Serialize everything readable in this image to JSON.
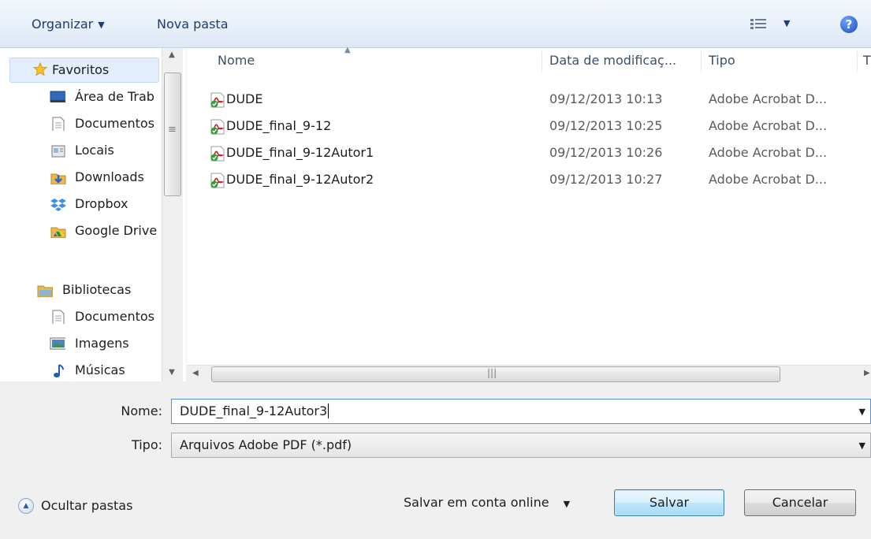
{
  "toolbar": {
    "organize_label": "Organizar",
    "new_folder_label": "Nova pasta",
    "help_glyph": "?"
  },
  "nav": {
    "favorites_label": "Favoritos",
    "items": [
      {
        "label": "Área de Trab",
        "icon": "desktop-icon"
      },
      {
        "label": "Documentos",
        "icon": "document-icon"
      },
      {
        "label": "Locais",
        "icon": "places-icon"
      },
      {
        "label": "Downloads",
        "icon": "downloads-icon"
      },
      {
        "label": "Dropbox",
        "icon": "dropbox-icon"
      },
      {
        "label": "Google Drive",
        "icon": "google-drive-icon"
      }
    ],
    "libraries_label": "Bibliotecas",
    "library_items": [
      {
        "label": "Documentos",
        "icon": "document-icon"
      },
      {
        "label": "Imagens",
        "icon": "pictures-icon"
      },
      {
        "label": "Músicas",
        "icon": "music-icon"
      }
    ]
  },
  "columns": {
    "name": "Nome",
    "modified": "Data de modificaç...",
    "type": "Tipo",
    "next": "T"
  },
  "files": [
    {
      "name": "DUDE",
      "modified": "09/12/2013 10:13",
      "type": "Adobe Acrobat D..."
    },
    {
      "name": "DUDE_final_9-12",
      "modified": "09/12/2013 10:25",
      "type": "Adobe Acrobat D..."
    },
    {
      "name": "DUDE_final_9-12Autor1",
      "modified": "09/12/2013 10:26",
      "type": "Adobe Acrobat D..."
    },
    {
      "name": "DUDE_final_9-12Autor2",
      "modified": "09/12/2013 10:27",
      "type": "Adobe Acrobat D..."
    }
  ],
  "form": {
    "name_label": "Nome:",
    "name_value": "DUDE_final_9-12Autor3",
    "type_label": "Tipo:",
    "type_value": "Arquivos Adobe PDF (*.pdf)"
  },
  "footer": {
    "hide_folders_label": "Ocultar pastas",
    "online_save_label": "Salvar em conta online",
    "save_label": "Salvar",
    "cancel_label": "Cancelar"
  },
  "colors": {
    "accent": "#3c7fb1",
    "toolbar_text": "#1e3c6e",
    "pdf_red": "#c8202a",
    "check_green": "#2f9e3a"
  }
}
